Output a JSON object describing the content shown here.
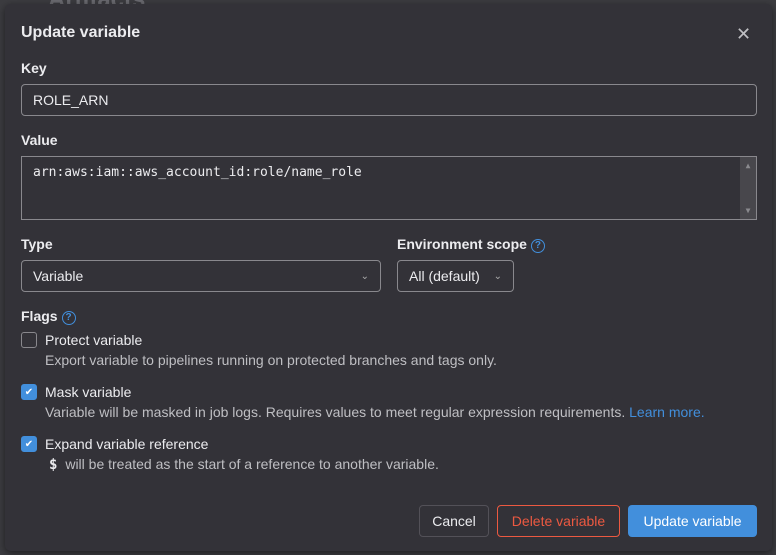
{
  "background": {
    "title": "Artifacts"
  },
  "modal": {
    "title": "Update variable",
    "close_icon": "close-icon",
    "key": {
      "label": "Key",
      "value": "ROLE_ARN"
    },
    "value": {
      "label": "Value",
      "value": "arn:aws:iam::aws_account_id:role/name_role"
    },
    "type": {
      "label": "Type",
      "selected": "Variable"
    },
    "env_scope": {
      "label": "Environment scope",
      "selected": "All (default)"
    },
    "flags": {
      "label": "Flags",
      "items": [
        {
          "title": "Protect variable",
          "desc": "Export variable to pipelines running on protected branches and tags only.",
          "checked": false
        },
        {
          "title": "Mask variable",
          "desc": "Variable will be masked in job logs. Requires values to meet regular expression requirements.",
          "link": "Learn more.",
          "checked": true
        },
        {
          "title": "Expand variable reference",
          "code": "$",
          "desc": "will be treated as the start of a reference to another variable.",
          "checked": true
        }
      ]
    },
    "buttons": {
      "cancel": "Cancel",
      "delete": "Delete variable",
      "update": "Update variable"
    },
    "colors": {
      "primary": "#428fdc",
      "danger": "#ec5941"
    }
  }
}
